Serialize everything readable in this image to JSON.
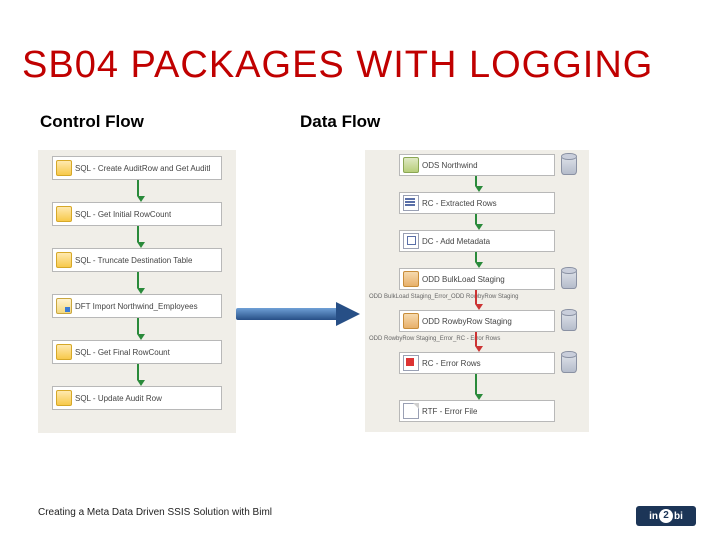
{
  "title": "SB04 PACKAGES WITH LOGGING",
  "columns": {
    "left": {
      "heading": "Control Flow"
    },
    "right": {
      "heading": "Data Flow"
    }
  },
  "control_flow": [
    {
      "label": "SQL - Create AuditRow and Get AuditI",
      "icon": "sql"
    },
    {
      "label": "SQL - Get Initial RowCount",
      "icon": "sql"
    },
    {
      "label": "SQL - Truncate Destination Table",
      "icon": "sql"
    },
    {
      "label": "DFT Import Northwind_Employees",
      "icon": "dft"
    },
    {
      "label": "SQL - Get Final RowCount",
      "icon": "sql"
    },
    {
      "label": "SQL - Update Audit Row",
      "icon": "sql"
    }
  ],
  "data_flow": [
    {
      "label": "ODS Northwind",
      "icon": "src",
      "arrow": "green"
    },
    {
      "label": "RC - Extracted Rows",
      "icon": "rc",
      "arrow": "green"
    },
    {
      "label": "DC - Add Metadata",
      "icon": "dc",
      "arrow": "green"
    },
    {
      "label": "ODD BulkLoad Staging",
      "icon": "dst",
      "arrow": "red",
      "err_note": "ODD BulkLoad Staging_Error_ODD RowbyRow Staging"
    },
    {
      "label": "ODD RowbyRow Staging",
      "icon": "dst",
      "arrow": "red",
      "err_note": "ODD RowbyRow Staging_Error_RC - Error Rows"
    },
    {
      "label": "RC - Error Rows",
      "icon": "err",
      "arrow": "green"
    },
    {
      "label": "RTF - Error File",
      "icon": "file",
      "arrow": null
    }
  ],
  "footer": "Creating a Meta Data Driven SSIS Solution with Biml",
  "logo": {
    "pre": "in",
    "mid": "2",
    "post": "bi"
  }
}
